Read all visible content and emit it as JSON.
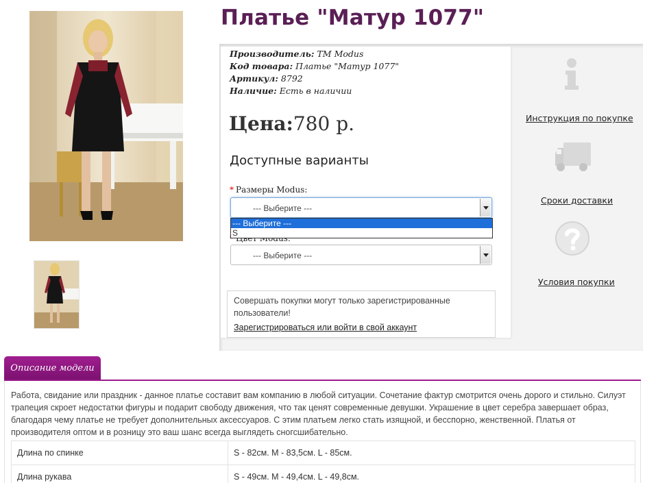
{
  "product": {
    "title": "Платье \"Матур 1077\"",
    "manufacturer_label": "Производитель:",
    "manufacturer_value": "TM Modus",
    "code_label": "Код товара:",
    "code_value": "Платье \"Матур 1077\"",
    "sku_label": "Артикул:",
    "sku_value": "8792",
    "stock_label": "Наличие:",
    "stock_value": "Есть в наличии",
    "price_label": "Цена:",
    "price_value": "780 р."
  },
  "options": {
    "heading": "Доступные варианты",
    "size": {
      "label": "Размеры Modus:",
      "selected": "--- Выберите ---",
      "dropdown": [
        "--- Выберите ---",
        "S"
      ]
    },
    "color": {
      "label": "Цвет Modus:",
      "selected": "--- Выберите ---"
    }
  },
  "login_notice": {
    "message": "Совершать покупки могут только зарегистрированные пользователи!",
    "link": "Зарегистрироваться или войти в свой аккаунт"
  },
  "sidebar": {
    "instructions": "Инструкция по покупке",
    "delivery": "Сроки доставки",
    "terms": "Условия покупки"
  },
  "tabs": {
    "description": "Описание модели"
  },
  "description": "Работа, свидание или праздник - данное платье составит вам компанию в любой ситуации. Сочетание фактур смотрится очень дорого и стильно. Силуэт трапеция скроет недостатки фигуры и подарит свободу движения, что так ценят современные девушки. Украшение в цвет серебра завершает образ, благодаря чему платье не требует дополнительных аксессуаров. С этим платьем легко стать изящной, и бесспорно, женственной. Платья от производителя оптом и в розницу это ваш шанс всегда выглядеть сногсшибательно.",
  "specs": [
    {
      "name": "Длина по спинке",
      "value": "S - 82см. M - 83,5см. L - 85см."
    },
    {
      "name": "Длина рукава",
      "value": "S - 49см. M - 49,4см. L - 49,8см."
    }
  ],
  "colors": {
    "title": "#5a1f55",
    "tab": "#8e1880",
    "selection": "#1e6fd9",
    "required": "#dd0000"
  }
}
